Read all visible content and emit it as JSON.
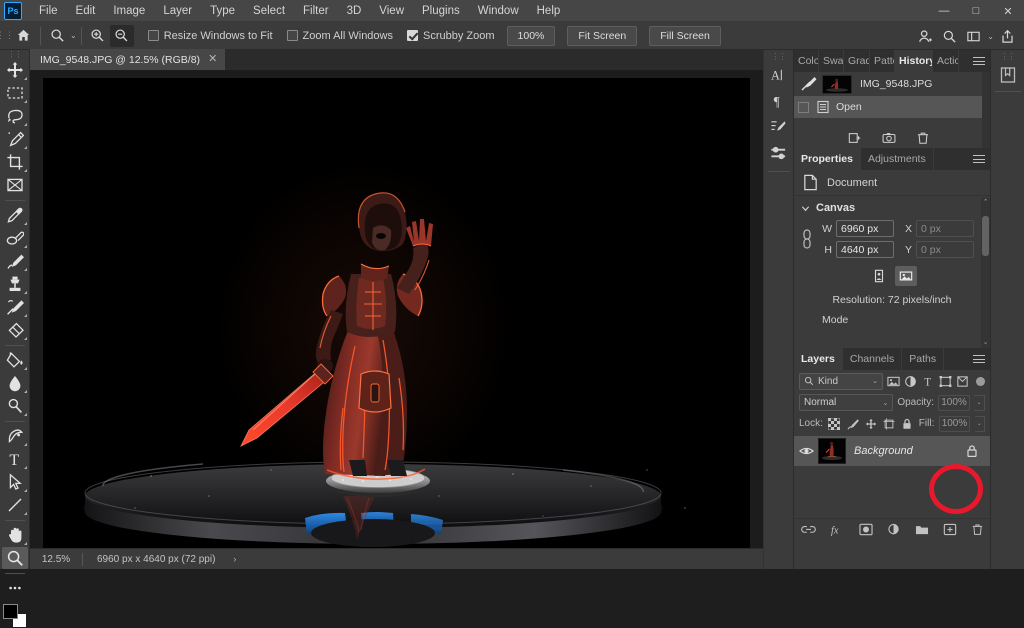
{
  "app": {
    "name": "Adobe Photoshop",
    "logo_text": "Ps"
  },
  "menubar": {
    "items": [
      {
        "label": "File"
      },
      {
        "label": "Edit"
      },
      {
        "label": "Image"
      },
      {
        "label": "Layer"
      },
      {
        "label": "Type"
      },
      {
        "label": "Select"
      },
      {
        "label": "Filter"
      },
      {
        "label": "3D"
      },
      {
        "label": "View"
      },
      {
        "label": "Plugins"
      },
      {
        "label": "Window"
      },
      {
        "label": "Help"
      }
    ],
    "window_controls": {
      "minimize": "—",
      "maximize": "□",
      "close": "✕"
    }
  },
  "options_bar": {
    "home_icon": "home-icon",
    "active_tool_icon": "zoom-tool-icon",
    "tool_preset_chevron": "⌄",
    "zoom_in_icon": "zoom-in-icon",
    "zoom_out_icon": "zoom-out-icon",
    "checkboxes": [
      {
        "label": "Resize Windows to Fit",
        "checked": false
      },
      {
        "label": "Zoom All Windows",
        "checked": false
      },
      {
        "label": "Scrubby Zoom",
        "checked": true
      }
    ],
    "buttons": [
      {
        "label": "100%"
      },
      {
        "label": "Fit Screen"
      },
      {
        "label": "Fill Screen"
      }
    ],
    "right_icons": [
      "add-user-icon",
      "search-icon",
      "workspace-icon",
      "share-icon"
    ]
  },
  "toolbar": {
    "tools": [
      {
        "name": "move-tool",
        "icon": "move-icon",
        "selected": false,
        "has_flyout": true
      },
      {
        "name": "marquee-tool",
        "icon": "rect-marquee-icon",
        "selected": false,
        "has_flyout": true
      },
      {
        "name": "lasso-tool",
        "icon": "lasso-icon",
        "selected": false,
        "has_flyout": true
      },
      {
        "name": "magic-wand-tool",
        "icon": "magic-wand-icon",
        "selected": false,
        "has_flyout": true
      },
      {
        "name": "crop-tool",
        "icon": "crop-icon",
        "selected": false,
        "has_flyout": true
      },
      {
        "name": "frame-tool",
        "icon": "frame-icon",
        "selected": false,
        "has_flyout": false
      },
      {
        "name": "eyedropper-tool",
        "icon": "eyedropper-icon",
        "selected": false,
        "has_flyout": true
      },
      {
        "name": "spot-healing-tool",
        "icon": "healing-brush-icon",
        "selected": false,
        "has_flyout": true
      },
      {
        "name": "brush-tool",
        "icon": "brush-icon",
        "selected": false,
        "has_flyout": true
      },
      {
        "name": "clone-stamp-tool",
        "icon": "clone-stamp-icon",
        "selected": false,
        "has_flyout": true
      },
      {
        "name": "history-brush-tool",
        "icon": "history-brush-icon",
        "selected": false,
        "has_flyout": true
      },
      {
        "name": "eraser-tool",
        "icon": "eraser-icon",
        "selected": false,
        "has_flyout": true
      },
      {
        "name": "gradient-tool",
        "icon": "paint-bucket-icon",
        "selected": false,
        "has_flyout": true
      },
      {
        "name": "blur-tool",
        "icon": "blur-droplet-icon",
        "selected": false,
        "has_flyout": true
      },
      {
        "name": "dodge-tool",
        "icon": "dodge-icon",
        "selected": false,
        "has_flyout": true
      },
      {
        "name": "pen-tool",
        "icon": "pen-icon",
        "selected": false,
        "has_flyout": true
      },
      {
        "name": "type-tool",
        "icon": "type-t-icon",
        "selected": false,
        "has_flyout": true
      },
      {
        "name": "path-selection-tool",
        "icon": "path-arrow-icon",
        "selected": false,
        "has_flyout": true
      },
      {
        "name": "line-tool",
        "icon": "line-shape-icon",
        "selected": false,
        "has_flyout": true
      },
      {
        "name": "hand-tool",
        "icon": "hand-icon",
        "selected": false,
        "has_flyout": true
      },
      {
        "name": "zoom-tool",
        "icon": "magnifier-icon",
        "selected": true,
        "has_flyout": false
      },
      {
        "name": "edit-toolbar",
        "icon": "ellipsis-icon",
        "selected": false,
        "has_flyout": false
      }
    ],
    "foreground_color": "#000000",
    "background_color": "#ffffff"
  },
  "document": {
    "tab_title": "IMG_9548.JPG @ 12.5% (RGB/8)",
    "close_glyph": "✕"
  },
  "canvas": {
    "description": "Photograph of a painted miniature figure on a black turntable",
    "background_color": "#000000",
    "subject": {
      "name": "hooded-warrior-miniature",
      "robe_color": "#8c2f28",
      "accent_glow": "#ff5a2b",
      "sword_color": "#e8392c",
      "base_color": "#b8b8b8"
    },
    "turntable": {
      "disc_color": "#2a2a2c",
      "led_color": "#1f6fd0"
    }
  },
  "statusbar": {
    "zoom": "12.5%",
    "info": "6960 px x 4640 px (72 ppi)",
    "arrow": "›"
  },
  "panel_rail": {
    "icons": [
      {
        "name": "character-panel-icon",
        "glyph": "A"
      },
      {
        "name": "paragraph-panel-icon",
        "glyph": "¶"
      },
      {
        "name": "brush-settings-panel-icon",
        "glyph": "brush"
      },
      {
        "name": "brushes-panel-icon",
        "glyph": "sliders"
      }
    ]
  },
  "history_panel": {
    "tabs": [
      {
        "label": "Color",
        "active": false
      },
      {
        "label": "Swatches",
        "active": false
      },
      {
        "label": "Gradients",
        "active": false
      },
      {
        "label": "Patterns",
        "active": false
      },
      {
        "label": "History",
        "active": true
      },
      {
        "label": "Actions",
        "active": false
      }
    ],
    "snapshot": {
      "label": "IMG_9548.JPG"
    },
    "states": [
      {
        "label": "Open",
        "selected": true
      }
    ],
    "footer_icons": [
      "new-document-from-state-icon",
      "new-snapshot-icon",
      "delete-icon"
    ]
  },
  "properties_panel": {
    "tabs": [
      {
        "label": "Properties",
        "active": true
      },
      {
        "label": "Adjustments",
        "active": false
      }
    ],
    "doc_row_label": "Document",
    "section_title": "Canvas",
    "fields": {
      "w_label": "W",
      "w_value": "6960 px",
      "h_label": "H",
      "h_value": "4640 px",
      "x_label": "X",
      "x_value": "0 px",
      "y_label": "Y",
      "y_value": "0 px"
    },
    "orientation": [
      {
        "name": "portrait-orientation",
        "selected": false
      },
      {
        "name": "landscape-orientation",
        "selected": true
      }
    ],
    "resolution": "Resolution: 72 pixels/inch",
    "mode_label": "Mode"
  },
  "layers_panel": {
    "tabs": [
      {
        "label": "Layers",
        "active": true
      },
      {
        "label": "Channels",
        "active": false
      },
      {
        "label": "Paths",
        "active": false
      }
    ],
    "filter": {
      "kind_label": "Kind",
      "icons": [
        "pixel-filter-icon",
        "adjustment-filter-icon",
        "type-filter-icon",
        "shape-filter-icon",
        "smart-object-filter-icon"
      ],
      "toggle_on": true
    },
    "blend_mode": "Normal",
    "opacity_label": "Opacity:",
    "opacity_value": "100%",
    "lock_label": "Lock:",
    "lock_icons": [
      "lock-transparent-pixels-icon",
      "lock-image-pixels-icon",
      "lock-position-icon",
      "lock-artboard-icon",
      "lock-all-icon"
    ],
    "fill_label": "Fill:",
    "fill_value": "100%",
    "layers": [
      {
        "name": "Background",
        "visible": true,
        "locked": true,
        "italic": true,
        "selected": true
      }
    ],
    "footer_icons": [
      "link-layers-icon",
      "layer-style-fx-icon",
      "add-layer-mask-icon",
      "new-adjustment-layer-icon",
      "new-group-icon",
      "new-layer-icon",
      "delete-layer-icon"
    ]
  },
  "annotation": {
    "shape": "circle",
    "color": "#e8192c",
    "target": "background-layer-lock-icon"
  },
  "edge_rail": {
    "icons": [
      {
        "name": "libraries-panel-icon"
      }
    ]
  }
}
